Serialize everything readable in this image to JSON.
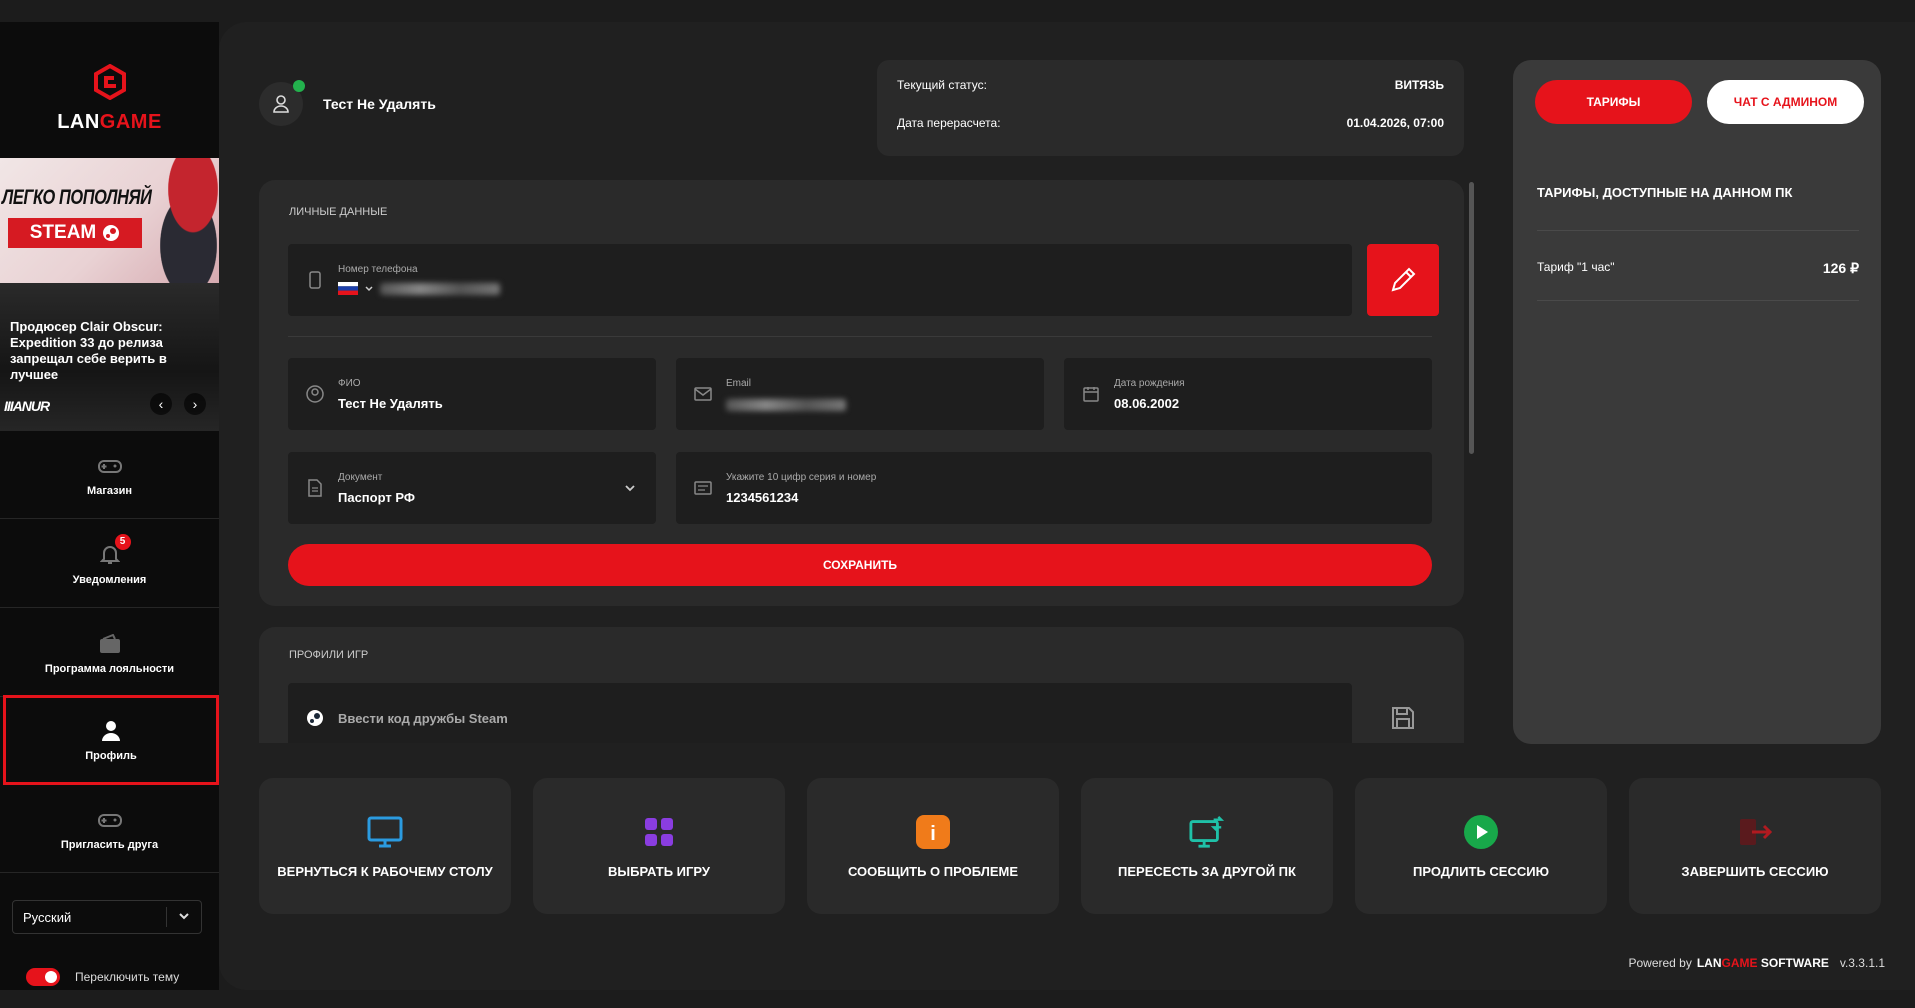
{
  "brand": {
    "logo_left": "LAN",
    "logo_right": "GAME"
  },
  "sidebar": {
    "banner_steam": {
      "headline": "ЛЕГКО ПОПОЛНЯЙ",
      "steam": "STEAM"
    },
    "banner_news": {
      "text": "Продюсер Clair Obscur: Expedition 33 до релиза запрещал себе верить в лучшее",
      "brand": "IIIANUR"
    },
    "items": [
      {
        "label": "Магазин",
        "icon": "gamepad-icon"
      },
      {
        "label": "Уведомления",
        "icon": "bell-icon",
        "badge": "5"
      },
      {
        "label": "Программа лояльности",
        "icon": "wallet-icon"
      },
      {
        "label": "Профиль",
        "icon": "user-icon",
        "active": true
      },
      {
        "label": "Пригласить друга",
        "icon": "gamepad-icon"
      }
    ],
    "language": "Русский",
    "theme_label": "Переключить тему"
  },
  "user": {
    "name": "Тест Не Удалять"
  },
  "status": {
    "current_label": "Текущий статус:",
    "current_value": "ВИТЯЗЬ",
    "recalc_label": "Дата перерасчета:",
    "recalc_value": "01.04.2026, 07:00"
  },
  "personal": {
    "title": "ЛИЧНЫЕ ДАННЫЕ",
    "phone_label": "Номер телефона",
    "fio_label": "ФИО",
    "fio_value": "Тест Не Удалять",
    "email_label": "Email",
    "birth_label": "Дата рождения",
    "birth_value": "08.06.2002",
    "doc_label": "Документ",
    "doc_value": "Паспорт РФ",
    "series_label": "Укажите 10 цифр серия и номер",
    "series_value": "1234561234",
    "save": "СОХРАНИТЬ"
  },
  "games": {
    "title": "ПРОФИЛИ ИГР",
    "steam_placeholder": "Ввести код дружбы Steam"
  },
  "tariffs": {
    "tab_tariffs": "ТАРИФЫ",
    "tab_chat": "ЧАТ С АДМИНОМ",
    "title": "ТАРИФЫ, ДОСТУПНЫЕ НА ДАННОМ ПК",
    "items": [
      {
        "name": "Тариф \"1 час\"",
        "price": "126 ₽"
      }
    ]
  },
  "actions": [
    {
      "label": "ВЕРНУТЬСЯ К РАБОЧЕМУ СТОЛУ",
      "icon": "monitor-icon",
      "color": "#2b9be0"
    },
    {
      "label": "ВЫБРАТЬ ИГРУ",
      "icon": "apps-grid-icon",
      "color": "#8a3de0"
    },
    {
      "label": "СООБЩИТЬ О ПРОБЛЕМЕ",
      "icon": "info-icon",
      "color": "#f07b1a"
    },
    {
      "label": "ПЕРЕСЕСТЬ ЗА ДРУГОЙ ПК",
      "icon": "switch-pc-icon",
      "color": "#1fc1a8"
    },
    {
      "label": "ПРОДЛИТЬ СЕССИЮ",
      "icon": "play-icon",
      "color": "#18a84a"
    },
    {
      "label": "ЗАВЕРШИТЬ СЕССИЮ",
      "icon": "logout-icon",
      "color": "#b01a20"
    }
  ],
  "footer": {
    "powered": "Powered by",
    "lan": "LAN",
    "game": "GAME",
    "software": "SOFTWARE",
    "version": "v.3.3.1.1"
  },
  "colors": {
    "accent": "#e6131b",
    "panel": "#2a2a2a",
    "background": "#202020"
  }
}
